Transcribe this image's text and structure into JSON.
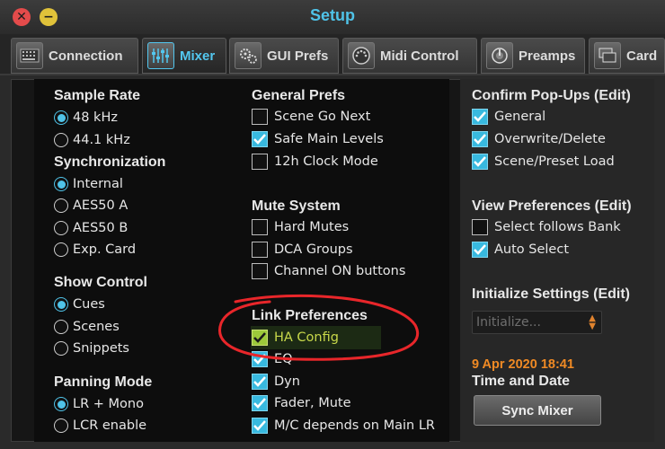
{
  "window": {
    "title": "Setup"
  },
  "tabs": [
    {
      "label": "Connection",
      "icon": "connection-icon"
    },
    {
      "label": "Mixer",
      "icon": "mixer-faders-icon",
      "active": true
    },
    {
      "label": "GUI Prefs",
      "icon": "gears-icon"
    },
    {
      "label": "Midi Control",
      "icon": "midi-port-icon"
    },
    {
      "label": "Preamps",
      "icon": "preamp-knob-icon"
    },
    {
      "label": "Card",
      "icon": "card-icon"
    }
  ],
  "sample_rate": {
    "title": "Sample Rate",
    "options": [
      {
        "label": "48 kHz",
        "selected": true
      },
      {
        "label": "44.1 kHz",
        "selected": false
      }
    ]
  },
  "synchronization": {
    "title": "Synchronization",
    "options": [
      {
        "label": "Internal",
        "selected": true
      },
      {
        "label": "AES50 A",
        "selected": false
      },
      {
        "label": "AES50 B",
        "selected": false
      },
      {
        "label": "Exp. Card",
        "selected": false
      }
    ]
  },
  "show_control": {
    "title": "Show Control",
    "options": [
      {
        "label": "Cues",
        "selected": true
      },
      {
        "label": "Scenes",
        "selected": false
      },
      {
        "label": "Snippets",
        "selected": false
      }
    ]
  },
  "panning_mode": {
    "title": "Panning Mode",
    "options": [
      {
        "label": "LR + Mono",
        "selected": true
      },
      {
        "label": "LCR enable",
        "selected": false
      }
    ]
  },
  "general_prefs": {
    "title": "General Prefs",
    "options": [
      {
        "label": "Scene Go Next",
        "checked": false
      },
      {
        "label": "Safe Main Levels",
        "checked": true
      },
      {
        "label": "12h Clock Mode",
        "checked": false
      }
    ]
  },
  "mute_system": {
    "title": "Mute System",
    "options": [
      {
        "label": "Hard Mutes",
        "checked": false
      },
      {
        "label": "DCA Groups",
        "checked": false
      },
      {
        "label": "Channel ON buttons",
        "checked": false
      }
    ]
  },
  "link_preferences": {
    "title": "Link Preferences",
    "options": [
      {
        "label": "HA Config",
        "checked": true,
        "highlighted": true
      },
      {
        "label": "EQ",
        "checked": true
      },
      {
        "label": "Dyn",
        "checked": true
      },
      {
        "label": "Fader, Mute",
        "checked": true
      },
      {
        "label": "M/C depends on Main LR",
        "checked": true
      }
    ]
  },
  "confirm_popups": {
    "title": "Confirm Pop-Ups (Edit)",
    "options": [
      {
        "label": "General",
        "checked": true
      },
      {
        "label": "Overwrite/Delete",
        "checked": true
      },
      {
        "label": "Scene/Preset Load",
        "checked": true
      }
    ]
  },
  "view_preferences": {
    "title": "View Preferences (Edit)",
    "options": [
      {
        "label": "Select follows Bank",
        "checked": false
      },
      {
        "label": "Auto Select",
        "checked": true
      }
    ]
  },
  "initialize_settings": {
    "title": "Initialize Settings (Edit)",
    "placeholder": "Initialize..."
  },
  "time_and_date": {
    "value": "9 Apr 2020 18:41",
    "label": "Time and Date"
  },
  "sync_button": {
    "label": "Sync Mixer"
  },
  "colors": {
    "accent": "#4fc3e8",
    "checkbox": "#38b9df",
    "highlight_text": "#c8d84a",
    "datetime": "#f08a24",
    "annotation": "#e8262a"
  }
}
